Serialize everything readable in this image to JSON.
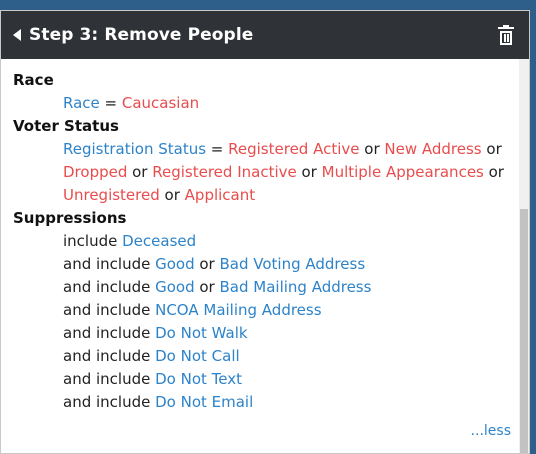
{
  "header": {
    "title": "Step 3: Remove People"
  },
  "race": {
    "heading": "Race",
    "field": "Race",
    "eq": " = ",
    "value": "Caucasian"
  },
  "voter_status": {
    "heading": "Voter Status",
    "field": "Registration Status",
    "eq": " = ",
    "or": " or ",
    "values": [
      "Registered Active",
      "New Address",
      "Dropped",
      "Registered Inactive",
      "Multiple Appearances",
      "Unregistered",
      "Applicant"
    ]
  },
  "suppressions": {
    "heading": "Suppressions",
    "include_first": "include ",
    "and_include": "and include ",
    "or": " or ",
    "items": [
      [
        "Deceased"
      ],
      [
        "Good",
        "Bad Voting Address"
      ],
      [
        "Good",
        "Bad Mailing Address"
      ],
      [
        "NCOA Mailing Address"
      ],
      [
        "Do Not Walk"
      ],
      [
        "Do Not Call"
      ],
      [
        "Do Not Text"
      ],
      [
        "Do Not Email"
      ]
    ]
  },
  "less_link": "...less",
  "colors": {
    "header_bg": "#2f3236",
    "link_blue": "#2d83c9",
    "value_red": "#e94c4c",
    "page_bg": "#2e5f8a"
  }
}
